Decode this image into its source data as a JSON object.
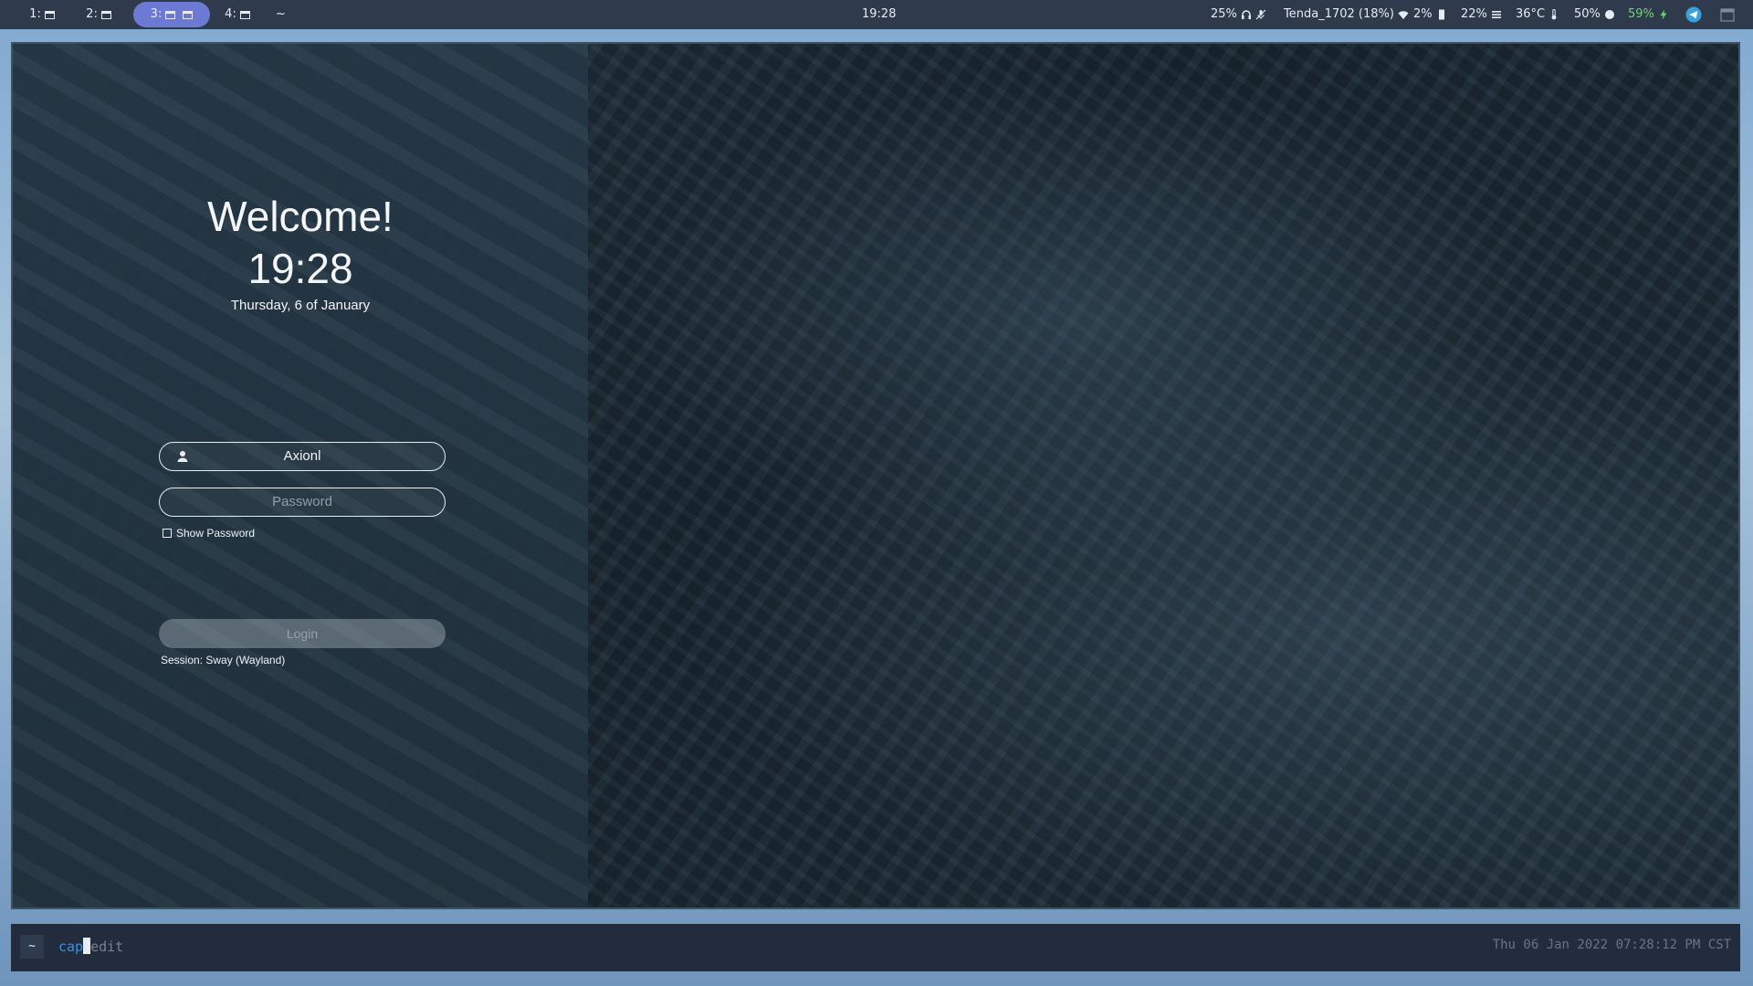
{
  "topbar": {
    "workspaces": [
      {
        "label": "1:"
      },
      {
        "label": "2:"
      },
      {
        "label": "3:"
      },
      {
        "label": "4:"
      }
    ],
    "scratch_label": "~",
    "clock": "19:28",
    "volume": "25%",
    "wifi": "Tenda_1702 (18%)",
    "cpu": "2%",
    "memory": "22%",
    "temperature": "36°C",
    "brightness": "50%",
    "battery": "59%",
    "battery_color": "#6fd36f"
  },
  "greeter": {
    "title": "Welcome!",
    "time": "19:28",
    "date": "Thursday, 6 of January",
    "username": "Axionl",
    "password_placeholder": "Password",
    "show_password_label": "Show Password",
    "login_label": "Login",
    "session": "Session: Sway (Wayland)"
  },
  "cmdbar": {
    "prompt": "~",
    "typed": "cap",
    "suggestion": "edit",
    "timestamp": "Thu 06 Jan 2022 07:28:12 PM CST"
  }
}
